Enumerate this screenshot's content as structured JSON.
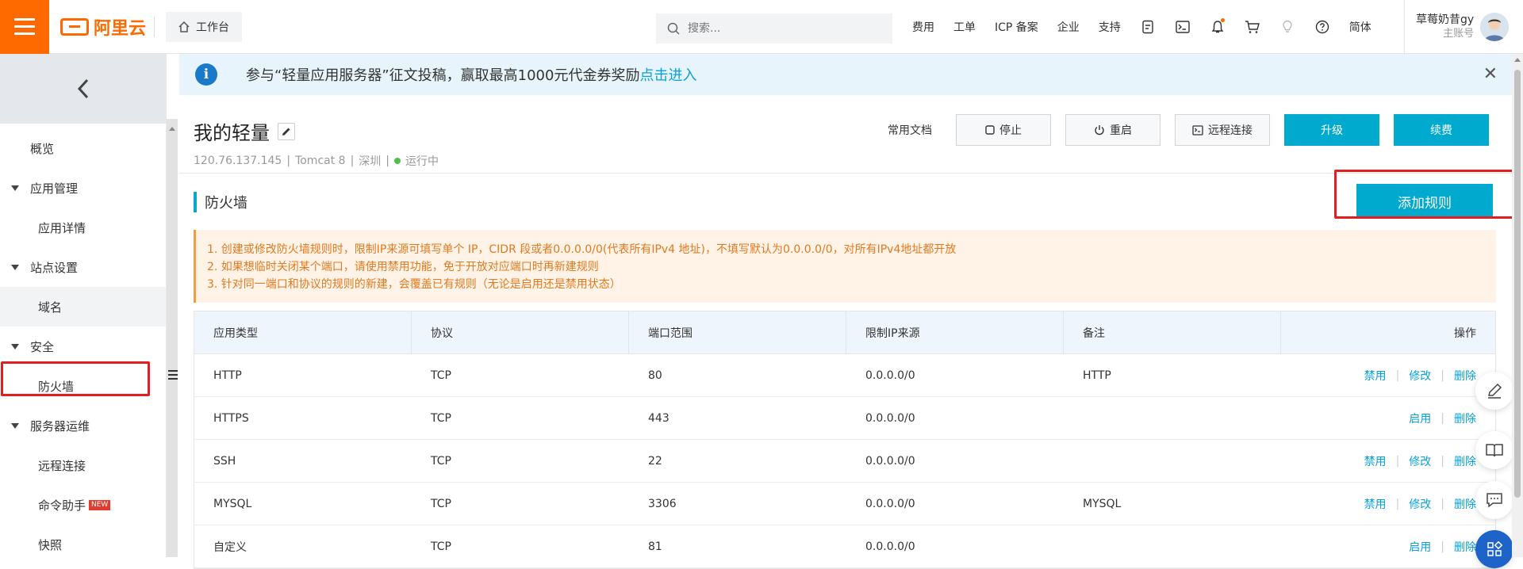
{
  "header": {
    "logo_text": "阿里云",
    "workbench": "工作台",
    "search_placeholder": "搜索...",
    "nav": [
      "费用",
      "工单",
      "ICP 备案",
      "企业",
      "支持"
    ],
    "lang": "简体",
    "username": "草莓奶昔gy",
    "account_type": "主账号"
  },
  "sidebar": {
    "overview": "概览",
    "groups": [
      {
        "label": "应用管理",
        "children": [
          "应用详情"
        ]
      },
      {
        "label": "站点设置",
        "children": [
          "域名"
        ]
      },
      {
        "label": "安全",
        "children": [
          "防火墙"
        ]
      },
      {
        "label": "服务器运维",
        "children": [
          "远程连接",
          "命令助手",
          "快照"
        ]
      }
    ],
    "new_badge": "NEW"
  },
  "notice": {
    "text": "参与“轻量应用服务器”征文投稿，赢取最高1000元代金券奖励",
    "link": "点击进入"
  },
  "server": {
    "title": "我的轻量",
    "ip": "120.76.137.145",
    "image": "Tomcat 8",
    "region": "深圳",
    "status": "运行中"
  },
  "actions": {
    "docs": "常用文档",
    "stop": "停止",
    "restart": "重启",
    "remote": "远程连接",
    "upgrade": "升级",
    "renew": "续费"
  },
  "firewall": {
    "title": "防火墙",
    "add_rule": "添加规则",
    "tips": [
      "1. 创建或修改防火墙规则时，限制IP来源可填写单个 IP，CIDR 段或者0.0.0.0/0(代表所有IPv4 地址)，不填写默认为0.0.0.0/0，对所有IPv4地址都开放",
      "2. 如果想临时关闭某个端口，请使用禁用功能，免于开放对应端口时再新建规则",
      "3. 针对同一端口和协议的规则的新建，会覆盖已有规则（无论是启用还是禁用状态）"
    ],
    "columns": [
      "应用类型",
      "协议",
      "端口范围",
      "限制IP来源",
      "备注",
      "操作"
    ],
    "rows": [
      {
        "app": "HTTP",
        "proto": "TCP",
        "port": "80",
        "ip": "0.0.0.0/0",
        "note": "HTTP",
        "toggle": "禁用",
        "edit": "修改",
        "del": "删除"
      },
      {
        "app": "HTTPS",
        "proto": "TCP",
        "port": "443",
        "ip": "0.0.0.0/0",
        "note": "",
        "toggle": "启用",
        "edit": "",
        "del": "删除"
      },
      {
        "app": "SSH",
        "proto": "TCP",
        "port": "22",
        "ip": "0.0.0.0/0",
        "note": "",
        "toggle": "禁用",
        "edit": "修改",
        "del": "删除"
      },
      {
        "app": "MYSQL",
        "proto": "TCP",
        "port": "3306",
        "ip": "0.0.0.0/0",
        "note": "MYSQL",
        "toggle": "禁用",
        "edit": "修改",
        "del": "删除"
      },
      {
        "app": "自定义",
        "proto": "TCP",
        "port": "81",
        "ip": "0.0.0.0/0",
        "note": "",
        "toggle": "启用",
        "edit": "",
        "del": "删除"
      }
    ]
  },
  "colors": {
    "brand": "#ff6a00",
    "primary": "#00aacf",
    "link": "#0aa0d6",
    "highlight": "#e02020"
  }
}
